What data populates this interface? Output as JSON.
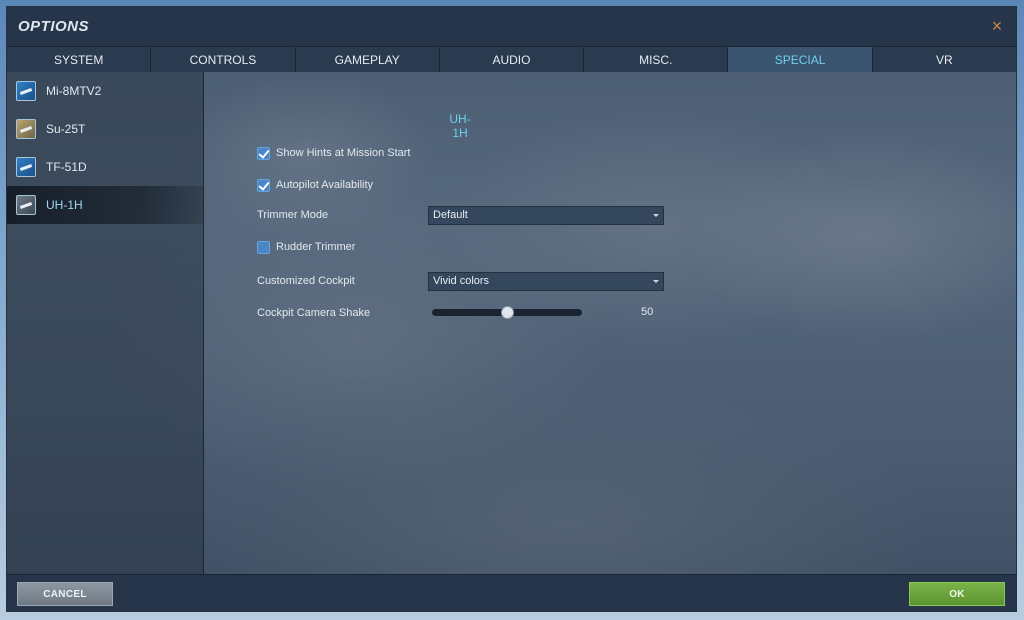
{
  "window": {
    "title": "OPTIONS",
    "close_glyph": "×"
  },
  "tabs": [
    {
      "label": "SYSTEM",
      "active": false
    },
    {
      "label": "CONTROLS",
      "active": false
    },
    {
      "label": "GAMEPLAY",
      "active": false
    },
    {
      "label": "AUDIO",
      "active": false
    },
    {
      "label": "MISC.",
      "active": false
    },
    {
      "label": "SPECIAL",
      "active": true
    },
    {
      "label": "VR",
      "active": false
    }
  ],
  "sidebar": {
    "items": [
      {
        "label": "Mi-8MTV2",
        "icon": "helicopter-icon"
      },
      {
        "label": "Su-25T",
        "icon": "jet-icon"
      },
      {
        "label": "TF-51D",
        "icon": "propeller-plane-icon"
      },
      {
        "label": "UH-1H",
        "icon": "helicopter-icon",
        "active": true
      }
    ]
  },
  "panel": {
    "title": "UH-1H",
    "show_hints": {
      "label": "Show Hints at Mission Start",
      "checked": true
    },
    "autopilot": {
      "label": "Autopilot Availability",
      "checked": true
    },
    "trimmer_mode": {
      "label": "Trimmer Mode",
      "value": "Default"
    },
    "rudder_trimmer": {
      "label": "Rudder Trimmer",
      "checked": false
    },
    "customized_cockpit": {
      "label": "Customized Cockpit",
      "value": "Vivid colors"
    },
    "camera_shake": {
      "label": "Cockpit Camera Shake",
      "value": "50",
      "fraction": 0.5
    }
  },
  "footer": {
    "cancel_label": "CANCEL",
    "ok_label": "OK"
  },
  "colors": {
    "accent": "#6fd0ee",
    "ok_green": "#6aa63d",
    "close_orange": "#c5874e"
  }
}
